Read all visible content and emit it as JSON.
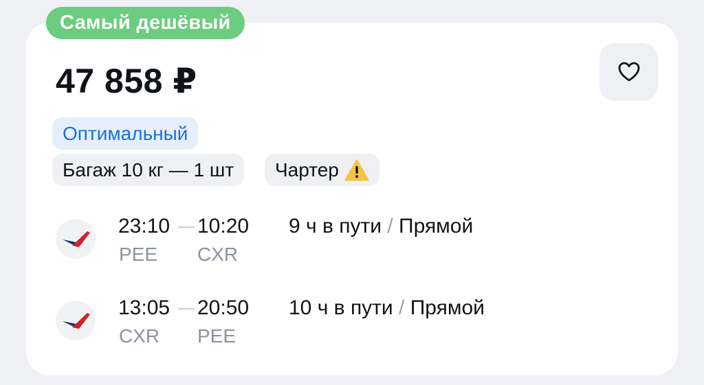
{
  "badge": {
    "label": "Самый дешёвый",
    "color": "#6ccc7f"
  },
  "price": {
    "text": "47 858 ₽"
  },
  "favorite": {
    "icon": "heart-outline-icon"
  },
  "tags": {
    "optimal": "Оптимальный",
    "baggage": "Багаж 10 кг — 1 шт",
    "charter": "Чартер",
    "charter_icon": "warning-icon"
  },
  "segments": [
    {
      "depart_time": "23:10",
      "arrive_time": "10:20",
      "from": "PEE",
      "to": "CXR",
      "duration": "9 ч в пути",
      "type": "Прямой",
      "airline_icon": "airline-logo-icon"
    },
    {
      "depart_time": "13:05",
      "arrive_time": "20:50",
      "from": "CXR",
      "to": "PEE",
      "duration": "10 ч в пути",
      "type": "Прямой",
      "airline_icon": "airline-logo-icon"
    }
  ],
  "separator": "/"
}
